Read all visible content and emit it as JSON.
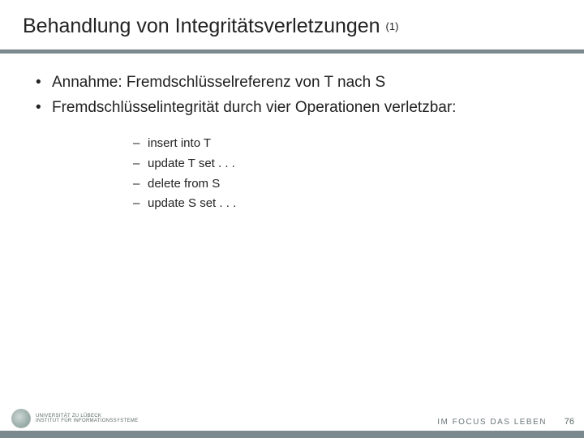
{
  "title": {
    "main": "Behandlung von Integritätsverletzungen",
    "sub": "(1)"
  },
  "bullets": [
    "Annahme: Fremdschlüsselreferenz von T nach S",
    "Fremdschlüsselintegrität durch vier Operationen verletzbar:"
  ],
  "sublist": [
    "insert into T",
    "update T set . . .",
    "delete from S",
    "update S set . . ."
  ],
  "footer": {
    "uni_line1": "UNIVERSITÄT ZU LÜBECK",
    "uni_line2": "INSTITUT FÜR INFORMATIONSSYSTEME",
    "motto": "IM FOCUS DAS LEBEN",
    "page": "76"
  }
}
